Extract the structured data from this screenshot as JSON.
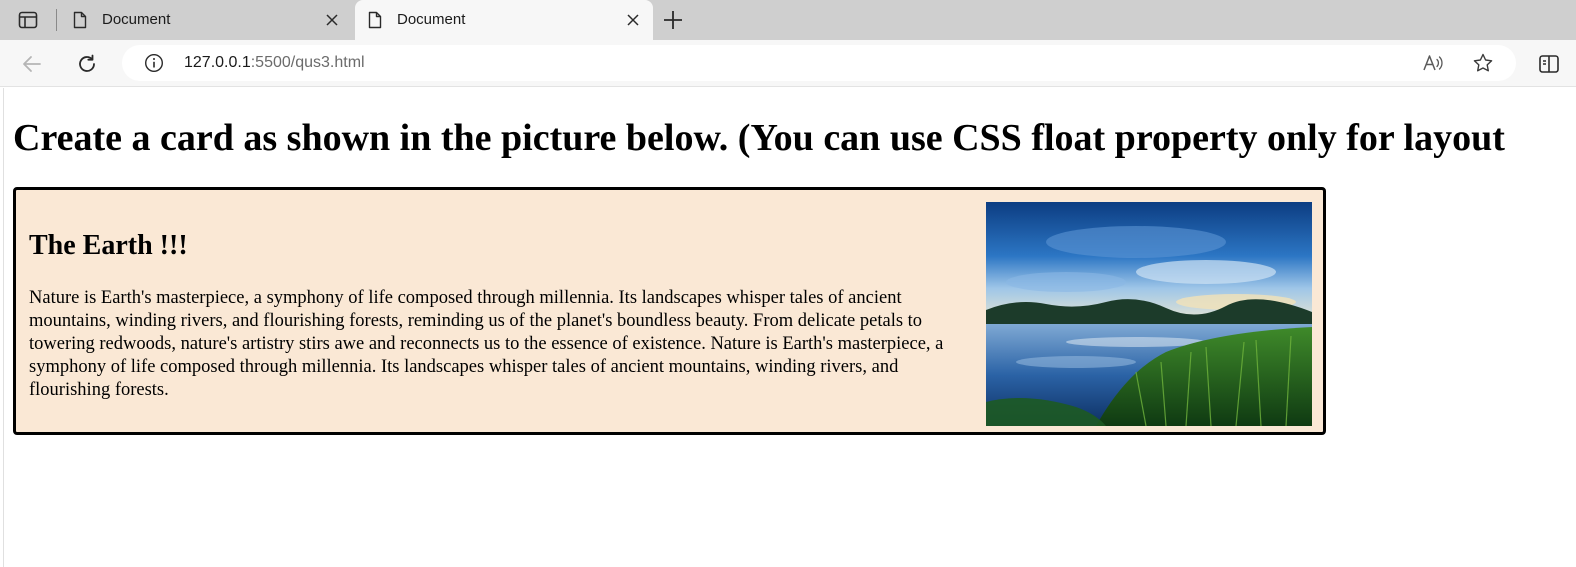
{
  "browser": {
    "tabs": [
      {
        "title": "Document",
        "active": false
      },
      {
        "title": "Document",
        "active": true
      }
    ],
    "address": {
      "host": "127.0.0.1",
      "path": ":5500/qus3.html"
    },
    "icons": {
      "tab_actions": "tab-actions-icon",
      "document": "document-icon",
      "close": "close-icon",
      "new_tab": "plus-icon",
      "back": "back-arrow-icon",
      "refresh": "refresh-icon",
      "site_info": "info-icon",
      "read_aloud": "read-aloud-icon",
      "favorite": "star-icon",
      "split_screen": "split-screen-icon"
    }
  },
  "page": {
    "heading": "Create a card as shown in the picture below. (You can use CSS float property only for layout",
    "card": {
      "title": "The Earth !!!",
      "paragraph": "Nature is Earth's masterpiece, a symphony of life composed through millennia. Its landscapes whisper tales of ancient mountains, winding rivers, and flourishing forests, reminding us of the planet's boundless beauty. From delicate petals to towering redwoods, nature's artistry stirs awe and reconnects us to the essence of existence. Nature is Earth's masterpiece, a symphony of life composed through millennia. Its landscapes whisper tales of ancient mountains, winding rivers, and flourishing forests.",
      "background_color": "#fae8d5",
      "border_color": "#000000"
    }
  }
}
